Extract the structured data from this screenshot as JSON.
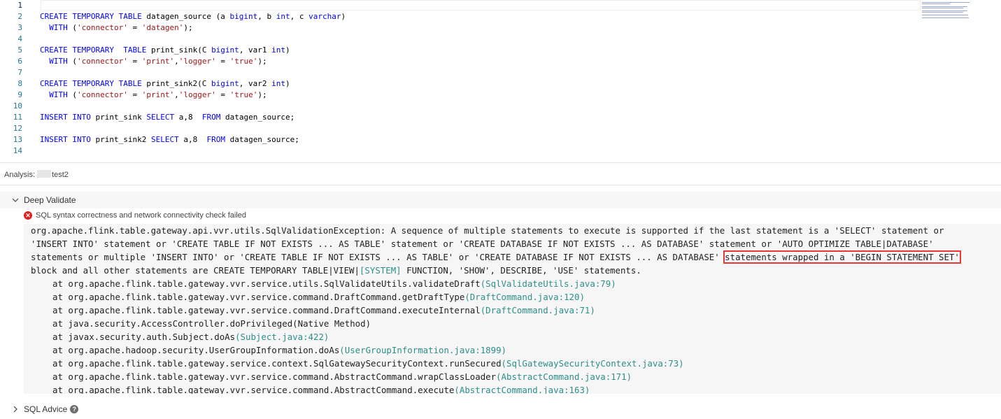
{
  "editor": {
    "line_numbers": [
      "1",
      "2",
      "3",
      "4",
      "5",
      "6",
      "7",
      "8",
      "9",
      "10",
      "11",
      "12",
      "13",
      "14"
    ],
    "lines": [
      [],
      [
        {
          "t": "CREATE TEMPORARY TABLE",
          "c": "kw"
        },
        {
          "t": " datagen_source (a "
        },
        {
          "t": "bigint",
          "c": "kw"
        },
        {
          "t": ", b "
        },
        {
          "t": "int",
          "c": "kw"
        },
        {
          "t": ", c "
        },
        {
          "t": "varchar",
          "c": "kw"
        },
        {
          "t": ")"
        }
      ],
      [
        {
          "t": "  "
        },
        {
          "t": "WITH",
          "c": "kw"
        },
        {
          "t": " ("
        },
        {
          "t": "'connector'",
          "c": "str"
        },
        {
          "t": " = "
        },
        {
          "t": "'datagen'",
          "c": "str"
        },
        {
          "t": ");"
        }
      ],
      [],
      [
        {
          "t": "CREATE TEMPORARY",
          "c": "kw"
        },
        {
          "t": "  "
        },
        {
          "t": "TABLE",
          "c": "kw"
        },
        {
          "t": " print_sink(C "
        },
        {
          "t": "bigint",
          "c": "kw"
        },
        {
          "t": ", var1 "
        },
        {
          "t": "int",
          "c": "kw"
        },
        {
          "t": ")"
        }
      ],
      [
        {
          "t": "  "
        },
        {
          "t": "WITH",
          "c": "kw"
        },
        {
          "t": " ("
        },
        {
          "t": "'connector'",
          "c": "str"
        },
        {
          "t": " = "
        },
        {
          "t": "'print'",
          "c": "str"
        },
        {
          "t": ","
        },
        {
          "t": "'logger'",
          "c": "str"
        },
        {
          "t": " = "
        },
        {
          "t": "'true'",
          "c": "str"
        },
        {
          "t": ");"
        }
      ],
      [],
      [
        {
          "t": "CREATE TEMPORARY TABLE",
          "c": "kw"
        },
        {
          "t": " print_sink2(C "
        },
        {
          "t": "bigint",
          "c": "kw"
        },
        {
          "t": ", var2 "
        },
        {
          "t": "int",
          "c": "kw"
        },
        {
          "t": ")"
        }
      ],
      [
        {
          "t": "  "
        },
        {
          "t": "WITH",
          "c": "kw"
        },
        {
          "t": " ("
        },
        {
          "t": "'connector'",
          "c": "str"
        },
        {
          "t": " = "
        },
        {
          "t": "'print'",
          "c": "str"
        },
        {
          "t": ","
        },
        {
          "t": "'logger'",
          "c": "str"
        },
        {
          "t": " = "
        },
        {
          "t": "'true'",
          "c": "str"
        },
        {
          "t": ");"
        }
      ],
      [],
      [
        {
          "t": "INSERT INTO",
          "c": "kw"
        },
        {
          "t": " print_sink "
        },
        {
          "t": "SELECT",
          "c": "kw"
        },
        {
          "t": " a,8  "
        },
        {
          "t": "FROM",
          "c": "kw"
        },
        {
          "t": " datagen_source;"
        }
      ],
      [],
      [
        {
          "t": "INSERT INTO",
          "c": "kw"
        },
        {
          "t": " print_sink2 "
        },
        {
          "t": "SELECT",
          "c": "kw"
        },
        {
          "t": " a,8  "
        },
        {
          "t": "FROM",
          "c": "kw"
        },
        {
          "t": " datagen_source;"
        }
      ],
      []
    ]
  },
  "analysis": {
    "label": "Analysis:",
    "value": "test2"
  },
  "deep_validate": {
    "title": "Deep Validate",
    "status_text": "SQL syntax correctness and network connectivity check failed",
    "message_lines": [
      [
        {
          "t": "org.apache.flink.table.gateway.api.vvr.utils.SqlValidationException: A sequence of multiple statements to execute is supported if the last statement is a 'SELECT' statement or"
        }
      ],
      [
        {
          "t": "'INSERT INTO' statement or 'CREATE TABLE IF NOT EXISTS ... AS TABLE' statement or 'CREATE DATABASE IF NOT EXISTS ... AS DATABASE' statement or 'AUTO OPTIMIZE TABLE|DATABASE'"
        }
      ],
      [
        {
          "t": "statements or multiple 'INSERT INTO' or 'CREATE TABLE IF NOT EXISTS ... AS TABLE' or 'CREATE DATABASE IF NOT EXISTS ... AS DATABASE' "
        },
        {
          "t": "statements wrapped in a 'BEGIN STATEMENT SET'",
          "c": "hl"
        }
      ],
      [
        {
          "t": "block and all other statements are CREATE TEMPORARY TABLE|VIEW|"
        },
        {
          "t": "[SYSTEM]",
          "c": "src"
        },
        {
          "t": " FUNCTION, 'SHOW', DESCRIBE, 'USE' statements."
        }
      ]
    ],
    "frames": [
      {
        "method": "at org.apache.flink.table.gateway.vvr.service.utils.SqlValidateUtils.validateDraft",
        "source": "(SqlValidateUtils.java:79)"
      },
      {
        "method": "at org.apache.flink.table.gateway.vvr.service.command.DraftCommand.getDraftType",
        "source": "(DraftCommand.java:120)"
      },
      {
        "method": "at org.apache.flink.table.gateway.vvr.service.command.DraftCommand.executeInternal",
        "source": "(DraftCommand.java:71)"
      },
      {
        "method": "at java.security.AccessController.doPrivileged(Native Method)",
        "source": ""
      },
      {
        "method": "at javax.security.auth.Subject.doAs",
        "source": "(Subject.java:422)"
      },
      {
        "method": "at org.apache.hadoop.security.UserGroupInformation.doAs",
        "source": "(UserGroupInformation.java:1899)"
      },
      {
        "method": "at org.apache.flink.table.gateway.service.context.SqlGatewaySecurityContext.runSecured",
        "source": "(SqlGatewaySecurityContext.java:73)"
      },
      {
        "method": "at org.apache.flink.table.gateway.vvr.service.command.AbstractCommand.wrapClassLoader",
        "source": "(AbstractCommand.java:171)"
      },
      {
        "method": "at org.apache.flink.table.gateway.vvr.service.command.AbstractCommand.execute",
        "source": "(AbstractCommand.java:163)"
      }
    ]
  },
  "sql_advice": {
    "title": "SQL Advice"
  },
  "icons": {
    "deep_validate_chevron": "chevron-down-icon",
    "sql_advice_chevron": "chevron-right-icon",
    "status_icon": "error-circle-icon",
    "help_icon": "question-circle-icon"
  },
  "colors": {
    "keyword": "#0000ff",
    "string": "#a31515",
    "line_number": "#237893",
    "source_link": "#2e8f8a",
    "error": "#e02020",
    "highlight_box": "#e53935"
  }
}
